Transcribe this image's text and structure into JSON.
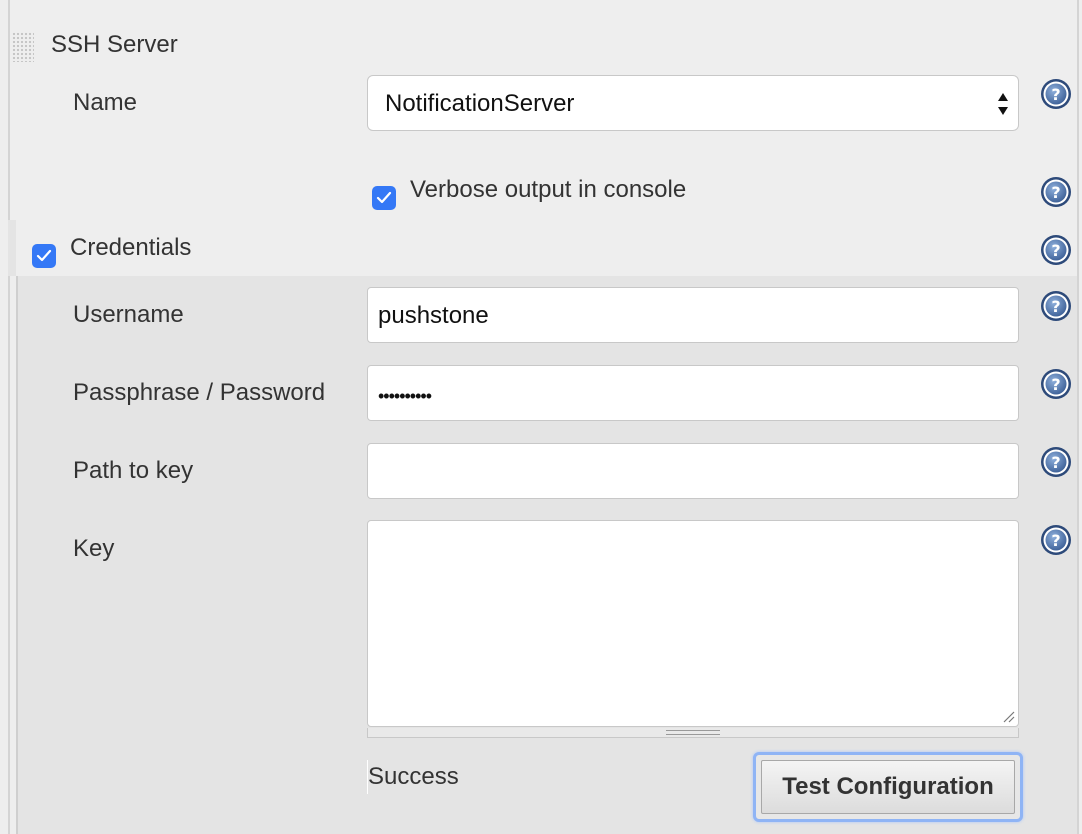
{
  "section": {
    "title": "SSH Server"
  },
  "name_field": {
    "label": "Name",
    "value": "NotificationServer"
  },
  "verbose": {
    "label": "Verbose output in console",
    "checked": true
  },
  "credentials": {
    "label": "Credentials",
    "checked": true,
    "username": {
      "label": "Username",
      "value": "pushstone"
    },
    "password": {
      "label": "Passphrase / Password",
      "value": "••••••••••"
    },
    "path_to_key": {
      "label": "Path to key",
      "value": ""
    },
    "key": {
      "label": "Key",
      "value": ""
    }
  },
  "status": {
    "text": "Success"
  },
  "test_button": {
    "label": "Test Configuration"
  },
  "icons": {
    "help": "help-icon",
    "checkbox": "checkmark-icon",
    "select_arrows": "select-arrows-icon",
    "drag_handle": "drag-handle-icon"
  },
  "colors": {
    "background": "#eeeeee",
    "credentials_panel": "#e4e4e4",
    "checkbox": "#3478f6",
    "help_icon": "#4a6fa5",
    "button_focus": "#8fb4f5"
  }
}
